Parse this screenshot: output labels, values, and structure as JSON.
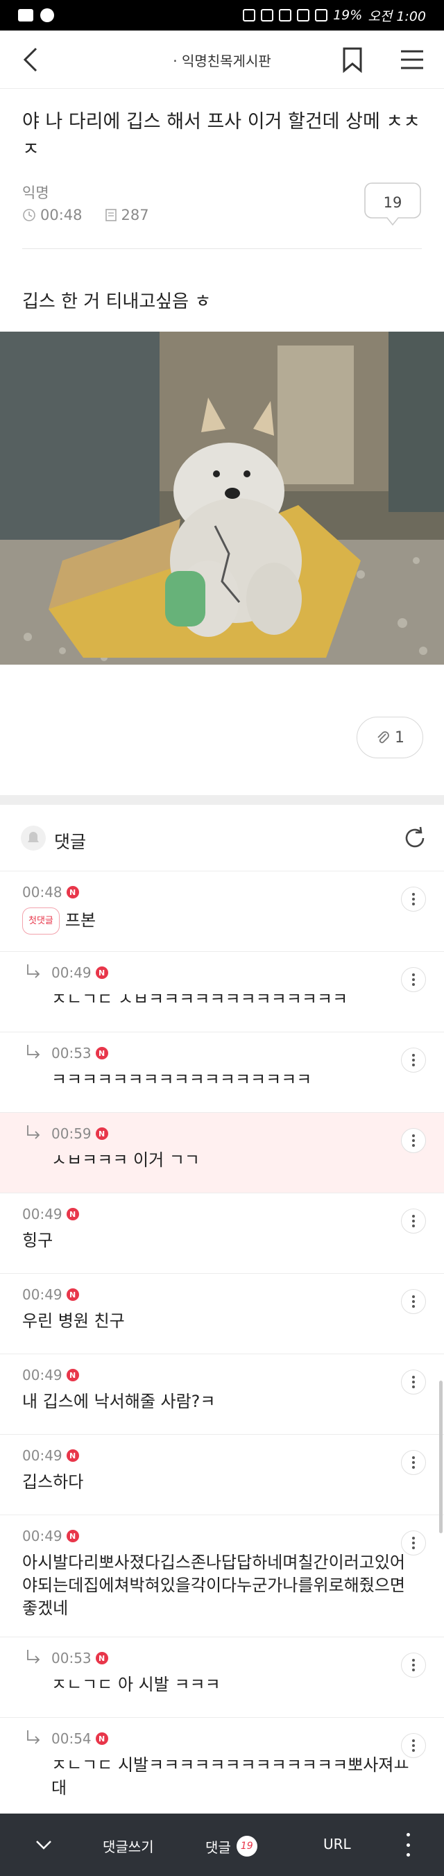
{
  "status_bar": {
    "battery": "19%",
    "time": "오전 1:00"
  },
  "nav": {
    "title": "· 익명친목게시판"
  },
  "post": {
    "title": "야 나 다리에 깁스 해서 프사 이거 할건데 상메 ㅊㅊㅈ",
    "author": "익명",
    "time": "00:48",
    "views": "287",
    "comment_count": "19",
    "body": "깁스 한 거 티내고싶음 ㅎ",
    "attachments": "1"
  },
  "comments_section": {
    "title": "댓글"
  },
  "comments": [
    {
      "time": "00:48",
      "badge": "N",
      "first_label": "첫댓글",
      "text": "프본",
      "reply": false,
      "highlight": false
    },
    {
      "time": "00:49",
      "badge": "N",
      "text": "ㅈㄴㄱㄷ ㅅㅂㅋㅋㅋㅋㅋㅋㅋㅋㅋㅋㅋㅋㅋ",
      "reply": true,
      "highlight": false
    },
    {
      "time": "00:53",
      "badge": "N",
      "text": "ㅋㅋㅋㅋㅋㅋㅋㅋㅋㅋㅋㅋㅋㅋㅋㅋㅋ",
      "reply": true,
      "highlight": false
    },
    {
      "time": "00:59",
      "badge": "N",
      "text": "ㅅㅂㅋㅋㅋ 이거 ㄱㄱ",
      "reply": true,
      "highlight": true
    },
    {
      "time": "00:49",
      "badge": "N",
      "text": "힝구",
      "reply": false,
      "highlight": false
    },
    {
      "time": "00:49",
      "badge": "N",
      "text": "우린 병원 친구",
      "reply": false,
      "highlight": false
    },
    {
      "time": "00:49",
      "badge": "N",
      "text": "내 깁스에 낙서해줄 사람?ㅋ",
      "reply": false,
      "highlight": false
    },
    {
      "time": "00:49",
      "badge": "N",
      "text": "깁스하다",
      "reply": false,
      "highlight": false
    },
    {
      "time": "00:49",
      "badge": "N",
      "text": "아시발다리뽀사졌다깁스존나답답하네며칠간이러고있어야되는데집에쳐박혀있을각이다누군가나를위로해줬으면좋겠네",
      "reply": false,
      "highlight": false
    },
    {
      "time": "00:53",
      "badge": "N",
      "text": "ㅈㄴㄱㄷ 아 시발 ㅋㅋㅋ",
      "reply": true,
      "highlight": false
    },
    {
      "time": "00:54",
      "badge": "N",
      "text": "ㅈㄴㄱㄷ 시발ㅋㅋㅋㅋㅋㅋㅋㅋㅋㅋㅋㅋㅋ뽀사져ㅛ대",
      "reply": true,
      "highlight": false
    }
  ],
  "bottom_bar": {
    "write": "댓글쓰기",
    "comments": "댓글",
    "comments_count": "19",
    "url": "URL"
  }
}
